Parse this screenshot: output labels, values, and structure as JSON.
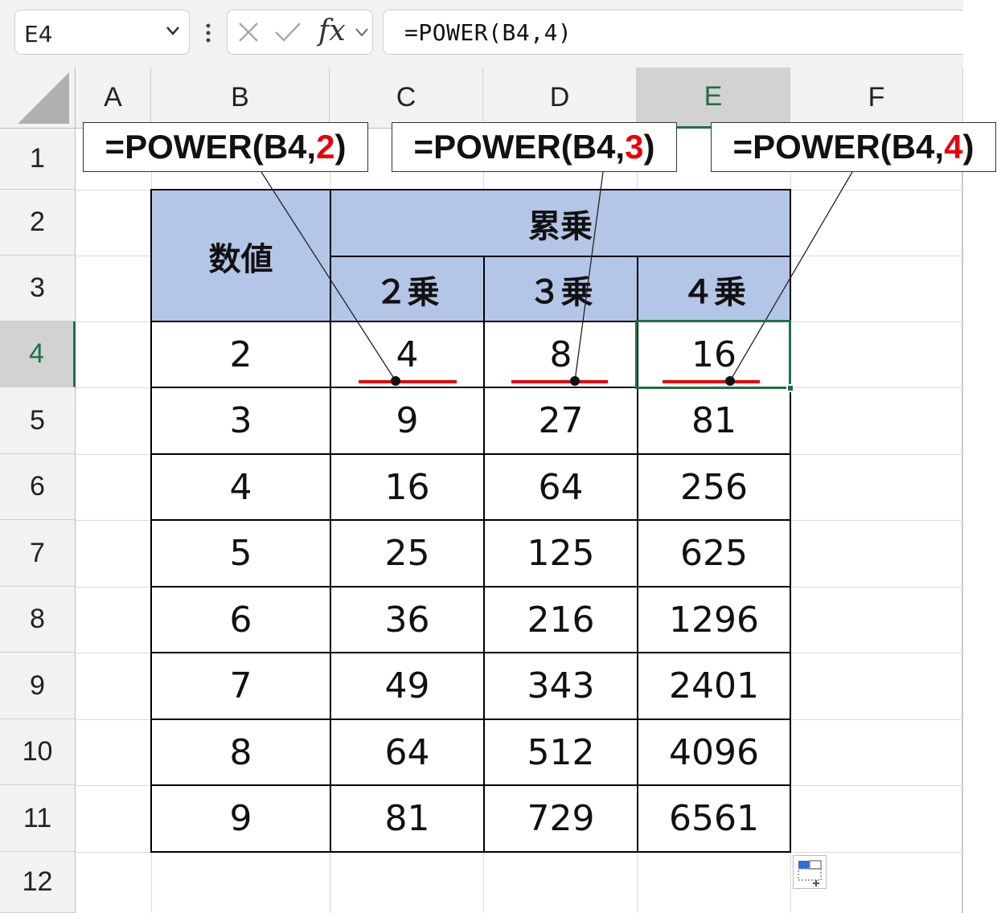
{
  "name_box": {
    "value": "E4"
  },
  "formula_bar": {
    "formula": "=POWER(B4,4)",
    "fx_label": "fx"
  },
  "columns": [
    "A",
    "B",
    "C",
    "D",
    "E",
    "F"
  ],
  "rows": [
    "1",
    "2",
    "3",
    "4",
    "5",
    "6",
    "7",
    "8",
    "9",
    "10",
    "11",
    "12"
  ],
  "selected": {
    "column": "E",
    "row": "4"
  },
  "table": {
    "header_number": "数値",
    "header_power": "累乗",
    "sub_headers": [
      "２乗",
      "３乗",
      "４乗"
    ],
    "rows": [
      [
        "2",
        "4",
        "8",
        "16"
      ],
      [
        "3",
        "9",
        "27",
        "81"
      ],
      [
        "4",
        "16",
        "64",
        "256"
      ],
      [
        "5",
        "25",
        "125",
        "625"
      ],
      [
        "6",
        "36",
        "216",
        "1296"
      ],
      [
        "7",
        "49",
        "343",
        "2401"
      ],
      [
        "8",
        "64",
        "512",
        "4096"
      ],
      [
        "9",
        "81",
        "729",
        "6561"
      ]
    ]
  },
  "callouts": [
    {
      "prefix": "=POWER(B4,",
      "exponent": "2",
      "suffix": ")"
    },
    {
      "prefix": "=POWER(B4,",
      "exponent": "3",
      "suffix": ")"
    },
    {
      "prefix": "=POWER(B4,",
      "exponent": "4",
      "suffix": ")"
    }
  ],
  "colors": {
    "accent": "#1e7145",
    "header_fill": "#b4c6e7",
    "highlight_red": "#e8000b"
  },
  "icons": [
    "chevron-down-icon",
    "more-options-icon",
    "cancel-icon",
    "enter-check-icon",
    "insert-function-icon",
    "quick-fill-options-icon"
  ]
}
